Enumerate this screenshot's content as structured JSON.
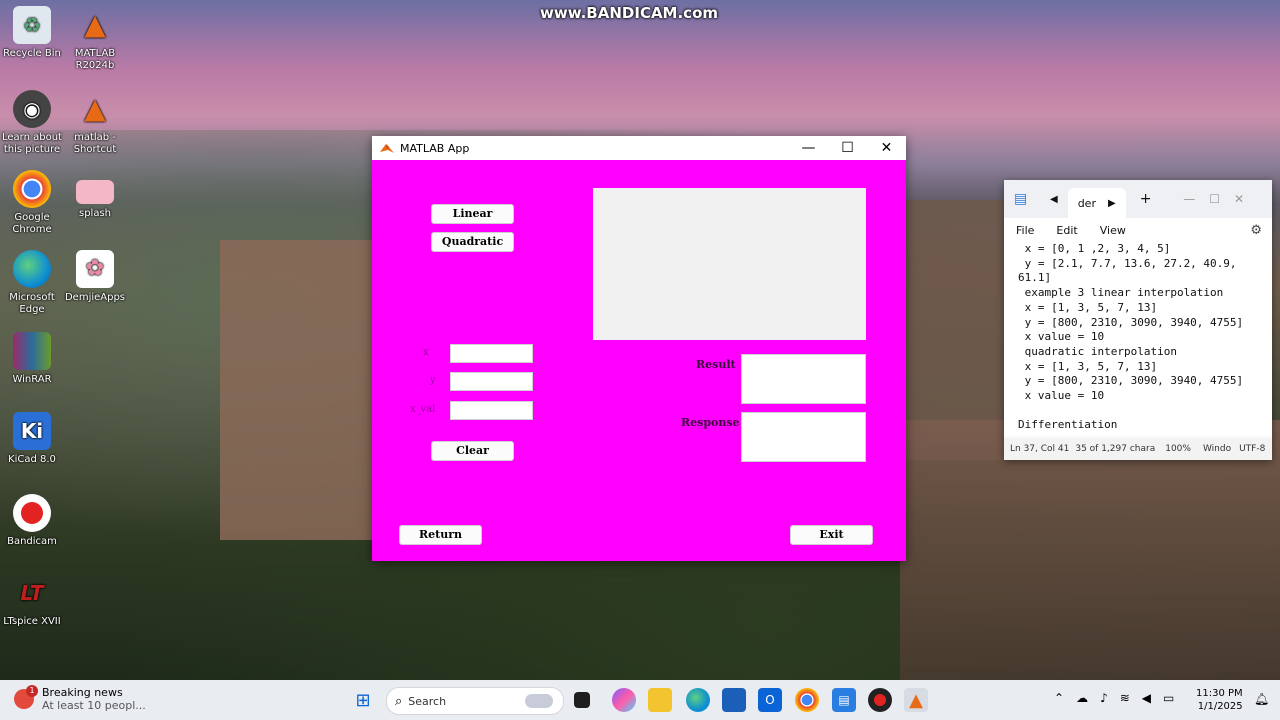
{
  "watermark": "www.BANDICAM.com",
  "desktop_icons": [
    {
      "label": "Recycle Bin",
      "icon": "recycle-bin-icon",
      "color": "#dfe7ef"
    },
    {
      "label": "MATLAB R2024b",
      "icon": "matlab-icon",
      "color": "#e86a17"
    },
    {
      "label": "Learn about this picture",
      "icon": "camera-icon",
      "color": "#444444"
    },
    {
      "label": "matlab - Shortcut",
      "icon": "matlab-icon",
      "color": "#e86a17"
    },
    {
      "label": "Google Chrome",
      "icon": "chrome-icon",
      "color": "#4285f4"
    },
    {
      "label": "splash",
      "icon": "image-icon",
      "color": "#f4b7c6"
    },
    {
      "label": "Microsoft Edge",
      "icon": "edge-icon",
      "color": "#0f8fd1"
    },
    {
      "label": "DemjieApps",
      "icon": "rose-icon",
      "color": "#f7b9c9"
    },
    {
      "label": "WinRAR",
      "icon": "winrar-icon",
      "color": "#9b2b6b"
    },
    {
      "label": "KiCad 8.0",
      "icon": "kicad-icon",
      "color": "#2a6fd6"
    },
    {
      "label": "Bandicam",
      "icon": "record-icon",
      "color": "#e32222"
    },
    {
      "label": "LTspice XVII",
      "icon": "ltspice-icon",
      "color": "#c21e1e"
    }
  ],
  "matlab_app": {
    "title": "MATLAB App",
    "minimize": "—",
    "maximize": "☐",
    "close": "✕",
    "bg_color": "#ff00ff",
    "buttons": {
      "linear": "Linear",
      "quadratic": "Quadratic",
      "clear": "Clear",
      "return": "Return",
      "exit": "Exit"
    },
    "labels": {
      "x": "x",
      "y": "y",
      "x_val": "x_val",
      "result": "Result",
      "response": "Response"
    }
  },
  "notepad": {
    "tab_label": "der",
    "menu": [
      "File",
      "Edit",
      "View"
    ],
    "lines": [
      " x = [0, 1 ,2, 3, 4, 5]",
      " y = [2.1, 7.7, 13.6, 27.2, 40.9,",
      "61.1]",
      " example 3 linear interpolation",
      " x = [1, 3, 5, 7, 13]",
      " y = [800, 2310, 3090, 3940, 4755]",
      " x value = 10",
      " quadratic interpolation",
      " x = [1, 3, 5, 7, 13]",
      " y = [800, 2310, 3090, 3940, 4755]",
      " x value = 10",
      "",
      "Differentiation"
    ],
    "status": {
      "position": "Ln 37, Col 41",
      "chars": "35 of 1,297 chara",
      "zoom": "100%",
      "line_ending": "Windo",
      "encoding": "UTF-8"
    }
  },
  "taskbar": {
    "news_title": "Breaking news",
    "news_sub": "At least 10 peopl...",
    "news_badge": "1",
    "search_placeholder": "Search",
    "time": "11:30 PM",
    "date": "1/1/2025"
  }
}
